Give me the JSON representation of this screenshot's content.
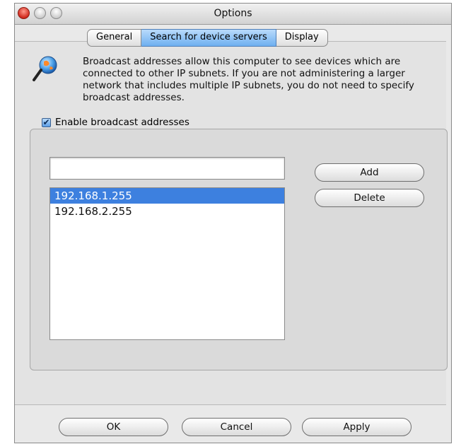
{
  "window": {
    "title": "Options"
  },
  "tabs": [
    {
      "label": "General"
    },
    {
      "label": "Search for device servers",
      "selected": true
    },
    {
      "label": "Display"
    }
  ],
  "pane": {
    "icon": "globe-magnifier-icon",
    "description": "Broadcast addresses allow this computer to see devices which are connected to other IP subnets. If you are not administering a larger network that includes multiple IP subnets, you do not need to specify broadcast addresses.",
    "enable_checkbox": {
      "label": "Enable broadcast addresses",
      "checked": true
    },
    "address_input": {
      "value": "",
      "placeholder": ""
    },
    "addresses": [
      "192.168.1.255",
      "192.168.2.255"
    ],
    "selected_address": "192.168.1.255",
    "add_label": "Add",
    "delete_label": "Delete"
  },
  "footer": {
    "ok_label": "OK",
    "cancel_label": "Cancel",
    "apply_label": "Apply"
  },
  "colors": {
    "selection": "#3d80df",
    "tab_selected": "#6eaff0",
    "close_button": "#d0291d"
  }
}
